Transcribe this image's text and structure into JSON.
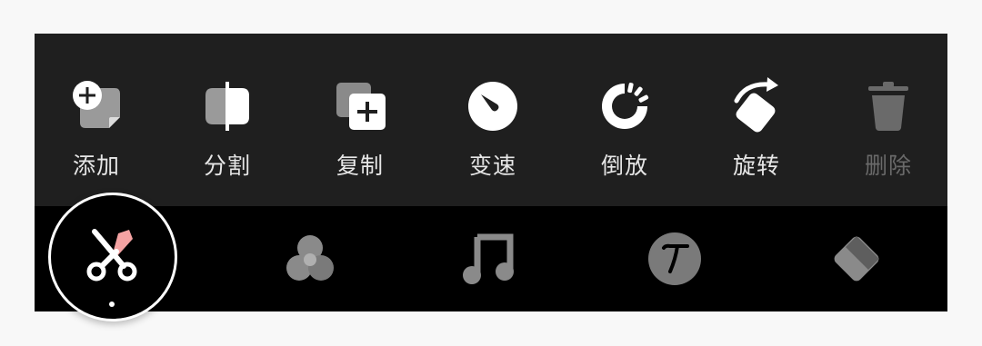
{
  "toolbar": {
    "items": [
      {
        "label": "添加",
        "icon": "add-clip-icon"
      },
      {
        "label": "分割",
        "icon": "split-icon"
      },
      {
        "label": "复制",
        "icon": "copy-icon"
      },
      {
        "label": "变速",
        "icon": "speed-icon"
      },
      {
        "label": "倒放",
        "icon": "reverse-icon"
      },
      {
        "label": "旋转",
        "icon": "rotate-icon"
      },
      {
        "label": "删除",
        "icon": "trash-icon",
        "disabled": true
      }
    ]
  },
  "tabs": [
    {
      "icon": "scissors-icon",
      "active": true
    },
    {
      "icon": "filter-circles-icon"
    },
    {
      "icon": "music-note-icon"
    },
    {
      "icon": "text-icon"
    },
    {
      "icon": "sticker-icon"
    }
  ],
  "colors": {
    "toolbar_bg": "#1f1f1f",
    "tabbar_bg": "#000000",
    "label": "#e6e6e6",
    "disabled_label": "#6a6a6a",
    "accent": "#f5a3a3"
  }
}
